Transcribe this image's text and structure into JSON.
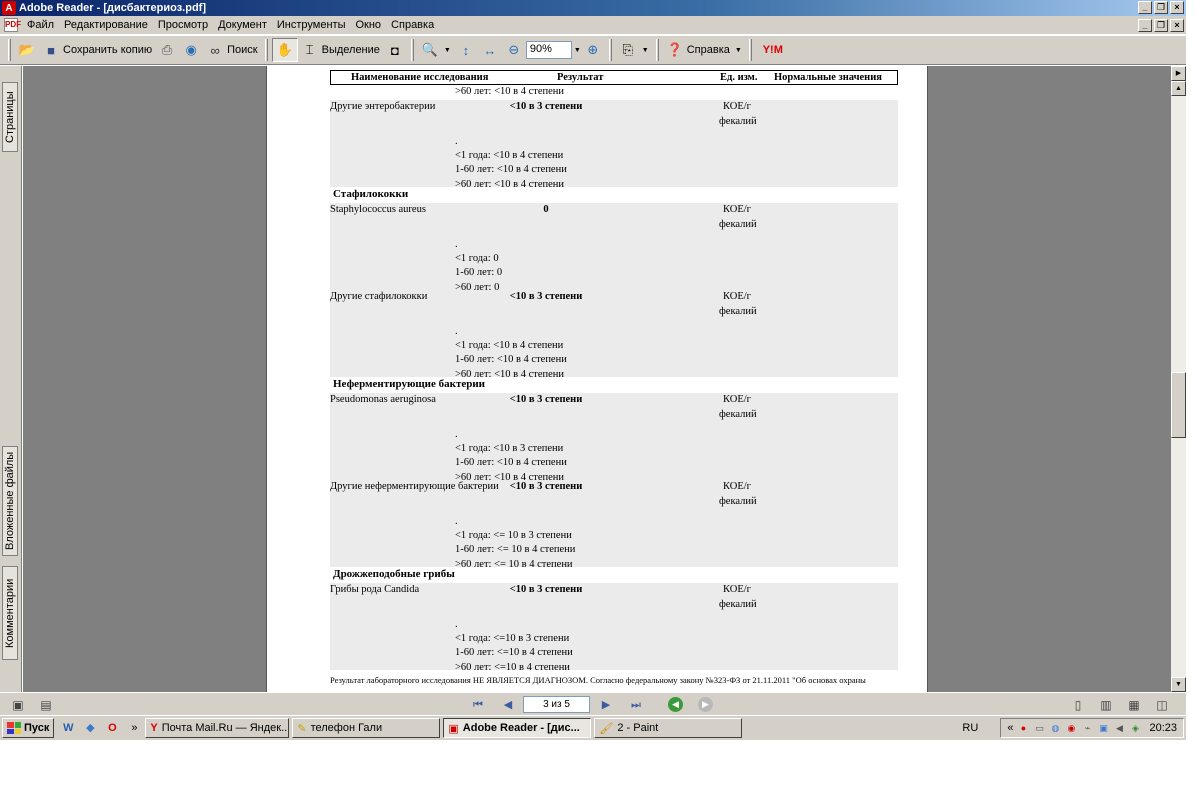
{
  "window": {
    "title": "Adobe Reader - [дисбактериоз.pdf]",
    "min": "_",
    "restore": "❐",
    "close": "×"
  },
  "menu": [
    "Файл",
    "Редактирование",
    "Просмотр",
    "Документ",
    "Инструменты",
    "Окно",
    "Справка"
  ],
  "toolbar": {
    "save_copy": "Сохранить копию",
    "search": "Поиск",
    "select": "Выделение",
    "zoom": "90%",
    "help": "Справка"
  },
  "left_tabs": {
    "pages": "Страницы",
    "attachments": "Вложенные файлы",
    "comments": "Комментарии"
  },
  "doc": {
    "headers": {
      "name": "Наименование исследования",
      "result": "Результат",
      "unit": "Ед. изм.",
      "norm": "Нормальные значения"
    },
    "top_line": ">60 лет: <10 в 4 степени",
    "rows": [
      {
        "name": "Другие энтеробактерии",
        "result": "<10 в 3 степени",
        "unit1": "КОЕ/г",
        "unit2": "фекалий",
        "dot": ".",
        "n1": "<1 года: <10 в 4 степени",
        "n2": "1-60 лет: <10 в 4 степени",
        "n3": ">60 лет: <10 в 4 степени"
      },
      {
        "section": "Стафилококки"
      },
      {
        "name": "Staphylococcus aureus",
        "result": "0",
        "unit1": "КОЕ/г",
        "unit2": "фекалий",
        "dot": ".",
        "n1": "<1 года: 0",
        "n2": "1-60 лет: 0",
        "n3": ">60 лет: 0"
      },
      {
        "name": "Другие стафилококки",
        "result": "<10 в 3 степени",
        "unit1": "КОЕ/г",
        "unit2": "фекалий",
        "dot": ".",
        "n1": "<1 года: <10 в 4 степени",
        "n2": "1-60 лет: <10 в 4 степени",
        "n3": ">60 лет: <10 в 4 степени"
      },
      {
        "section": "Неферментирующие бактерии"
      },
      {
        "name": "Pseudomonas aeruginosa",
        "result": "<10 в 3 степени",
        "unit1": "КОЕ/г",
        "unit2": "фекалий",
        "dot": ".",
        "n1": "<1 года: <10 в 3 степени",
        "n2": "1-60 лет: <10 в 4 степени",
        "n3": ">60 лет: <10 в 4 степени"
      },
      {
        "name": "Другие неферментирующие бактерии",
        "result": "<10 в 3 степени",
        "unit1": "КОЕ/г",
        "unit2": "фекалий",
        "dot": ".",
        "n1": "<1 года: <= 10 в 3 степени",
        "n2": "1-60 лет: <= 10 в 4 степени",
        "n3": ">60 лет: <= 10 в 4 степени"
      },
      {
        "section": "Дрожжеподобные грибы"
      },
      {
        "name": "Грибы рода Candida",
        "result": "<10 в 3 степени",
        "unit1": "КОЕ/г",
        "unit2": "фекалий",
        "dot": ".",
        "n1": "<1 года: <=10 в 3 степени",
        "n2": "1-60 лет: <=10 в 4 степени",
        "n3": ">60 лет: <=10 в 4 степени"
      }
    ],
    "footer": "Результат лабораторного исследования НЕ ЯВЛЯЕТСЯ ДИАГНОЗОМ. Согласно федеральному закону №323-ФЗ от 21.11.2011 \"Об основах охраны"
  },
  "status": {
    "page": "3 из 5"
  },
  "taskbar": {
    "start": "Пуск",
    "more": "»",
    "tasks": [
      {
        "label": "Почта Mail.Ru — Яндек..."
      },
      {
        "label": "телефон Гали"
      },
      {
        "label": "Adobe Reader - [дис..."
      },
      {
        "label": "2 - Paint"
      }
    ],
    "lang": "RU",
    "tray_more": "«",
    "clock": "20:23"
  }
}
